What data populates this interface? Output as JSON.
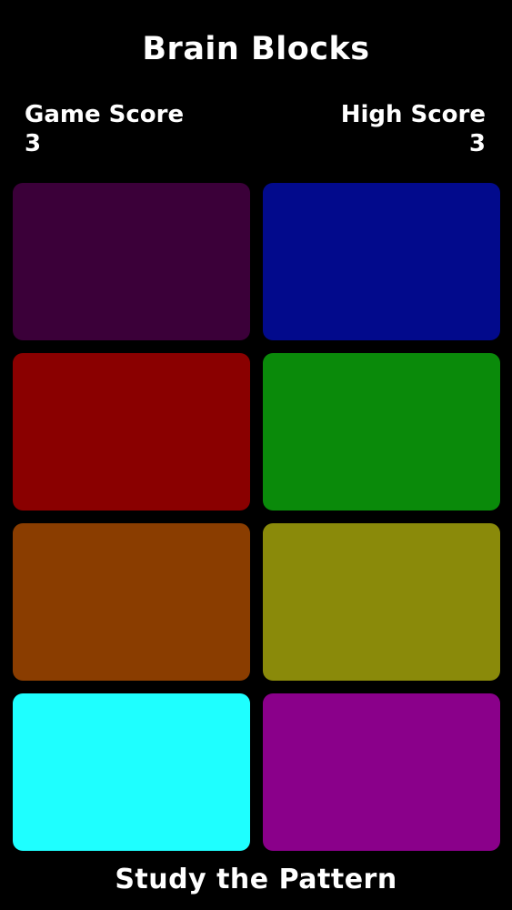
{
  "title": "Brain Blocks",
  "game_score": {
    "label": "Game Score",
    "value": "3"
  },
  "high_score": {
    "label": "High Score",
    "value": "3"
  },
  "blocks": [
    {
      "name": "block-dark-purple",
      "color": "#3b0039"
    },
    {
      "name": "block-blue",
      "color": "#020a8c"
    },
    {
      "name": "block-red",
      "color": "#8a0000"
    },
    {
      "name": "block-green",
      "color": "#0a8a0a"
    },
    {
      "name": "block-orange",
      "color": "#8a3d00"
    },
    {
      "name": "block-olive",
      "color": "#8a8a0a"
    },
    {
      "name": "block-cyan",
      "color": "#1effff"
    },
    {
      "name": "block-magenta",
      "color": "#8a008a"
    }
  ],
  "status": "Study the Pattern"
}
